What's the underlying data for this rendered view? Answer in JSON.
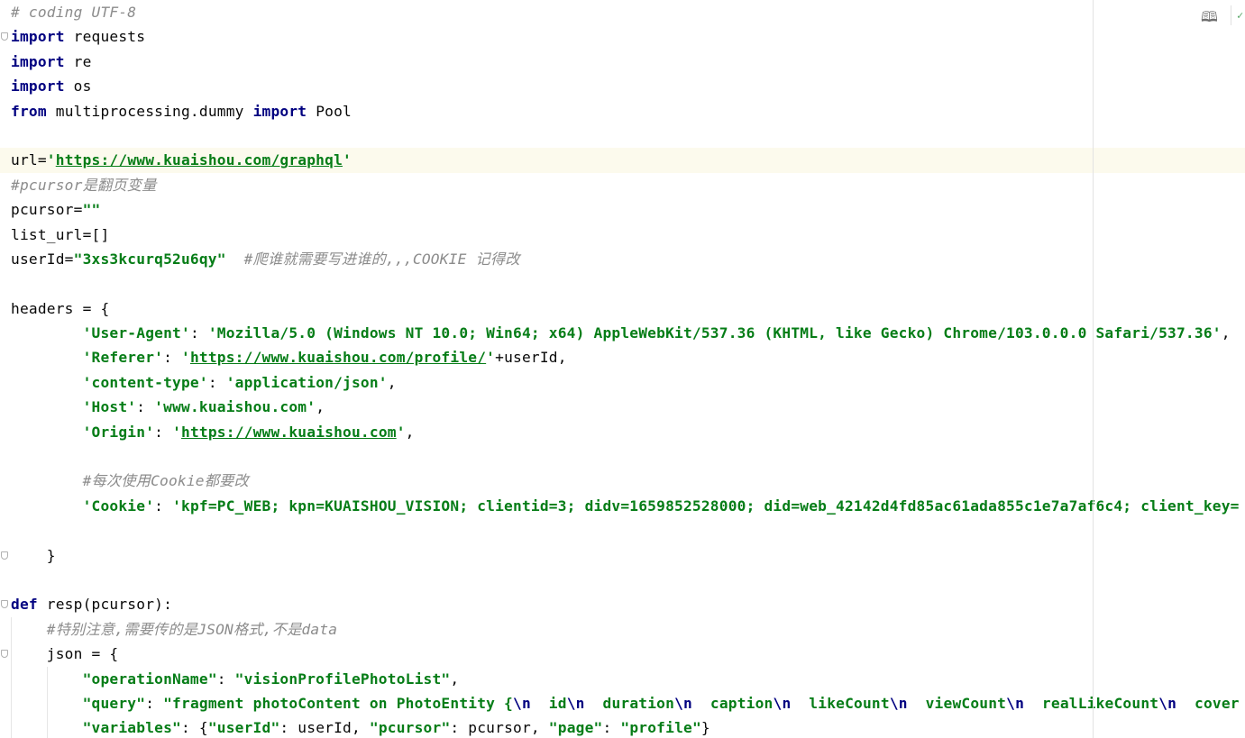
{
  "editor": {
    "current_line": 6,
    "colors": {
      "keyword": "#000080",
      "string": "#067d17",
      "comment": "#8c8c8c",
      "current_line_bg": "#fcfaed"
    },
    "toolbar": {
      "reader_mode_icon": "book-icon",
      "inspection_icon": "check-icon"
    },
    "lines": [
      {
        "tokens": [
          [
            "c",
            "# coding UTF-8"
          ]
        ]
      },
      {
        "fold": true,
        "tokens": [
          [
            "k",
            "import"
          ],
          [
            "p",
            " requests"
          ]
        ]
      },
      {
        "tokens": [
          [
            "k",
            "import"
          ],
          [
            "p",
            " re"
          ]
        ]
      },
      {
        "tokens": [
          [
            "k",
            "import"
          ],
          [
            "p",
            " os"
          ]
        ]
      },
      {
        "tokens": [
          [
            "k",
            "from"
          ],
          [
            "p",
            " multiprocessing.dummy "
          ],
          [
            "k",
            "import"
          ],
          [
            "p",
            " Pool"
          ]
        ]
      },
      {
        "tokens": []
      },
      {
        "tokens": [
          [
            "p",
            "url="
          ],
          [
            "s",
            "'"
          ],
          [
            "su",
            "https://www.kuaishou.com/graphql"
          ],
          [
            "s",
            "'"
          ]
        ]
      },
      {
        "tokens": [
          [
            "c",
            "#pcursor是翻页变量"
          ]
        ]
      },
      {
        "tokens": [
          [
            "p",
            "pcursor="
          ],
          [
            "s",
            "\"\""
          ]
        ]
      },
      {
        "tokens": [
          [
            "p",
            "list_url=[]"
          ]
        ]
      },
      {
        "tokens": [
          [
            "p",
            "userId="
          ],
          [
            "s",
            "\"3xs3kcurq52u6qy\""
          ],
          [
            "p",
            "  "
          ],
          [
            "c",
            "#爬谁就需要写进谁的,,,COOKIE 记得改"
          ]
        ]
      },
      {
        "tokens": []
      },
      {
        "tokens": [
          [
            "p",
            "headers = {"
          ]
        ]
      },
      {
        "tokens": [
          [
            "p",
            "        "
          ],
          [
            "s",
            "'User-Agent'"
          ],
          [
            "p",
            ": "
          ],
          [
            "s",
            "'Mozilla/5.0 (Windows NT 10.0; Win64; x64) AppleWebKit/537.36 (KHTML, like Gecko) Chrome/103.0.0.0 Safari/537.36'"
          ],
          [
            "p",
            ","
          ]
        ]
      },
      {
        "tokens": [
          [
            "p",
            "        "
          ],
          [
            "s",
            "'Referer'"
          ],
          [
            "p",
            ": "
          ],
          [
            "s",
            "'"
          ],
          [
            "su",
            "https://www.kuaishou.com/profile/"
          ],
          [
            "s",
            "'"
          ],
          [
            "p",
            "+userId,"
          ]
        ]
      },
      {
        "tokens": [
          [
            "p",
            "        "
          ],
          [
            "s",
            "'content-type'"
          ],
          [
            "p",
            ": "
          ],
          [
            "s",
            "'application/json'"
          ],
          [
            "p",
            ","
          ]
        ]
      },
      {
        "tokens": [
          [
            "p",
            "        "
          ],
          [
            "s",
            "'Host'"
          ],
          [
            "p",
            ": "
          ],
          [
            "s",
            "'www.kuaishou.com'"
          ],
          [
            "p",
            ","
          ]
        ]
      },
      {
        "tokens": [
          [
            "p",
            "        "
          ],
          [
            "s",
            "'Origin'"
          ],
          [
            "p",
            ": "
          ],
          [
            "s",
            "'"
          ],
          [
            "su",
            "https://www.kuaishou.com"
          ],
          [
            "s",
            "'"
          ],
          [
            "p",
            ","
          ]
        ]
      },
      {
        "tokens": []
      },
      {
        "tokens": [
          [
            "p",
            "        "
          ],
          [
            "c",
            "#每次使用Cookie都要改"
          ]
        ]
      },
      {
        "tokens": [
          [
            "p",
            "        "
          ],
          [
            "s",
            "'Cookie'"
          ],
          [
            "p",
            ": "
          ],
          [
            "s",
            "'kpf=PC_WEB; kpn=KUAISHOU_VISION; clientid=3; didv=1659852528000; did=web_42142d4fd85ac61ada855c1e7a7af6c4; client_key="
          ]
        ]
      },
      {
        "tokens": []
      },
      {
        "fold": true,
        "tokens": [
          [
            "p",
            "    }"
          ]
        ]
      },
      {
        "tokens": []
      },
      {
        "fold": true,
        "tokens": [
          [
            "k",
            "def"
          ],
          [
            "p",
            " resp(pcursor):"
          ]
        ]
      },
      {
        "guides": [
          12
        ],
        "tokens": [
          [
            "p",
            "    "
          ],
          [
            "c",
            "#特别注意,需要传的是JSON格式,不是data"
          ]
        ]
      },
      {
        "fold": true,
        "guides": [
          12
        ],
        "tokens": [
          [
            "p",
            "    json = {"
          ]
        ]
      },
      {
        "guides": [
          12,
          52
        ],
        "tokens": [
          [
            "p",
            "        "
          ],
          [
            "s",
            "\"operationName\""
          ],
          [
            "p",
            ": "
          ],
          [
            "s",
            "\"visionProfilePhotoList\""
          ],
          [
            "p",
            ","
          ]
        ]
      },
      {
        "guides": [
          12,
          52
        ],
        "tokens": [
          [
            "p",
            "        "
          ],
          [
            "s",
            "\"query\""
          ],
          [
            "p",
            ": "
          ],
          [
            "s",
            "\"fragment photoContent on PhotoEntity {"
          ],
          [
            "e",
            "\\n"
          ],
          [
            "s",
            "  id"
          ],
          [
            "e",
            "\\n"
          ],
          [
            "s",
            "  duration"
          ],
          [
            "e",
            "\\n"
          ],
          [
            "s",
            "  caption"
          ],
          [
            "e",
            "\\n"
          ],
          [
            "s",
            "  likeCount"
          ],
          [
            "e",
            "\\n"
          ],
          [
            "s",
            "  viewCount"
          ],
          [
            "e",
            "\\n"
          ],
          [
            "s",
            "  realLikeCount"
          ],
          [
            "e",
            "\\n"
          ],
          [
            "s",
            "  cover"
          ]
        ]
      },
      {
        "guides": [
          12,
          52
        ],
        "tokens": [
          [
            "p",
            "        "
          ],
          [
            "s",
            "\"variables\""
          ],
          [
            "p",
            ": {"
          ],
          [
            "s",
            "\"userId\""
          ],
          [
            "p",
            ": userId, "
          ],
          [
            "s",
            "\"pcursor\""
          ],
          [
            "p",
            ": pcursor, "
          ],
          [
            "s",
            "\"page\""
          ],
          [
            "p",
            ": "
          ],
          [
            "s",
            "\"profile\""
          ],
          [
            "p",
            "}"
          ]
        ]
      }
    ]
  }
}
